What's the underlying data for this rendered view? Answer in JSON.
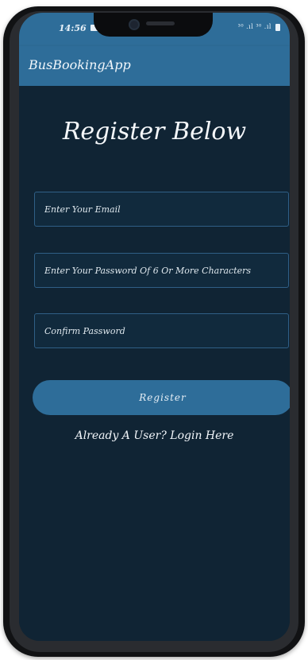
{
  "status_bar": {
    "time": "14:56",
    "indicators": "³⁰ .ıl ³⁰ .ıl"
  },
  "app_bar": {
    "title": "BusBookingApp"
  },
  "form": {
    "heading": "Register Below",
    "email_placeholder": "Enter Your Email",
    "password_placeholder": "Enter Your Password Of 6 Or More Characters",
    "confirm_placeholder": "Confirm Password",
    "register_label": "Register",
    "login_link": "Already A User? Login Here"
  },
  "colors": {
    "accent": "#2e6d99",
    "background": "#102434",
    "field_border": "#2f5f86"
  },
  "icons": {
    "status_image": "image-icon",
    "battery": "battery-icon"
  }
}
